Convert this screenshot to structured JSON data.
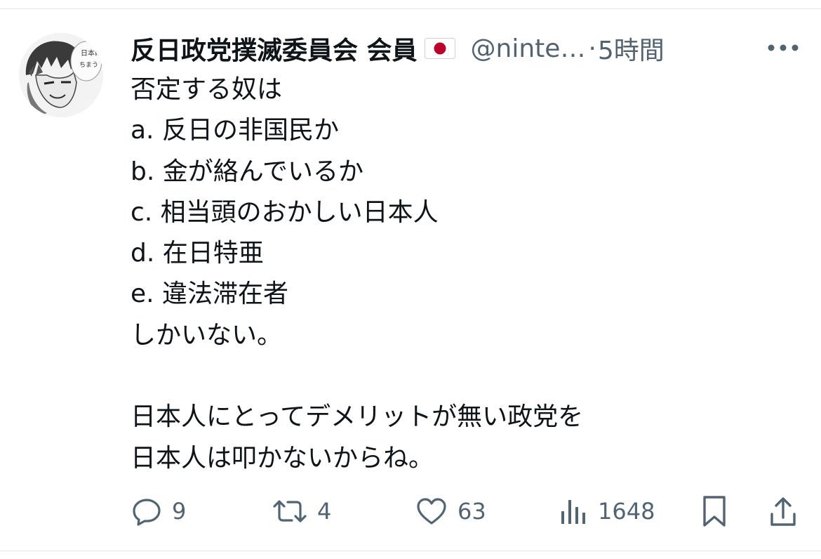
{
  "tweet": {
    "display_name": "反日政党撲滅委員会 会員",
    "flag_icon": "japan-flag-icon",
    "handle": "@ninte…",
    "separator": "·",
    "time": "5時間",
    "more_icon": "more-horizontal-icon",
    "lines": [
      "否定する奴は",
      "a. 反日の非国民か",
      "b. 金が絡んでいるか",
      "c. 相当頭のおかしい日本人",
      "d. 在日特亜",
      "e. 違法滞在者",
      "しかいない。",
      "",
      "日本人にとってデメリットが無い政党を",
      "日本人は叩かないからね。"
    ],
    "avatar_text": "日本にちまうゾ"
  },
  "actions": {
    "reply": {
      "icon": "reply-icon",
      "count": "9"
    },
    "retweet": {
      "icon": "retweet-icon",
      "count": "4"
    },
    "like": {
      "icon": "heart-icon",
      "count": "63"
    },
    "views": {
      "icon": "analytics-icon",
      "count": "1648"
    },
    "bookmark": {
      "icon": "bookmark-icon"
    },
    "share": {
      "icon": "share-icon"
    }
  },
  "colors": {
    "text": "#0f1419",
    "secondary": "#536471",
    "flag_red": "#bc002d"
  }
}
